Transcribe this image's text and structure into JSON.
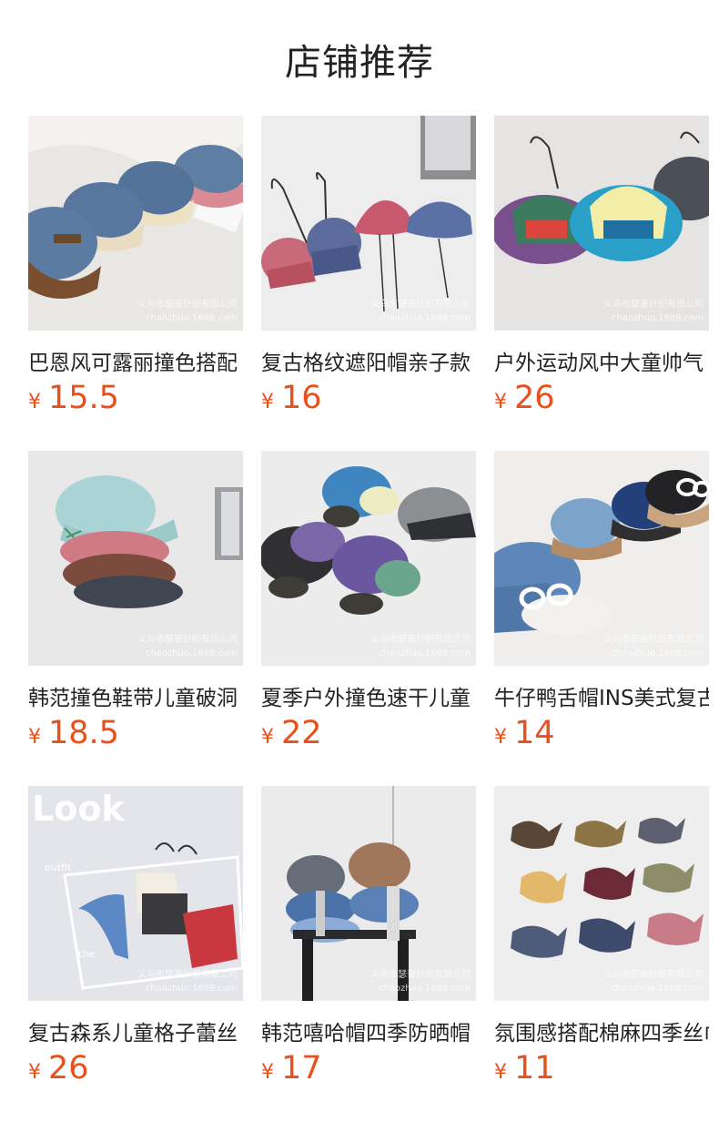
{
  "section": {
    "title": "店铺推荐"
  },
  "watermark": {
    "line1": "义乌市瑟奋针织有限公司",
    "line2": "chaozhuo.1688.com"
  },
  "overlay": {
    "look_text": "Look",
    "outfit_text": "outfit",
    "the_text": "the"
  },
  "currency": "¥",
  "products": [
    {
      "name": "巴恩风可露丽撞色搭配",
      "price": "15.5"
    },
    {
      "name": "复古格纹遮阳帽亲子款",
      "price": "16"
    },
    {
      "name": "户外运动风中大童帅气",
      "price": "26"
    },
    {
      "name": "韩范撞色鞋带儿童破洞",
      "price": "18.5"
    },
    {
      "name": "夏季户外撞色速干儿童",
      "price": "22"
    },
    {
      "name": "牛仔鸭舌帽INS美式复古",
      "price": "14"
    },
    {
      "name": "复古森系儿童格子蕾丝",
      "price": "26"
    },
    {
      "name": "韩范嘻哈帽四季防晒帽",
      "price": "17"
    },
    {
      "name": "氛围感搭配棉麻四季丝巾",
      "price": "11"
    }
  ],
  "colors": {
    "price": "#e8501c",
    "title": "#222222"
  }
}
